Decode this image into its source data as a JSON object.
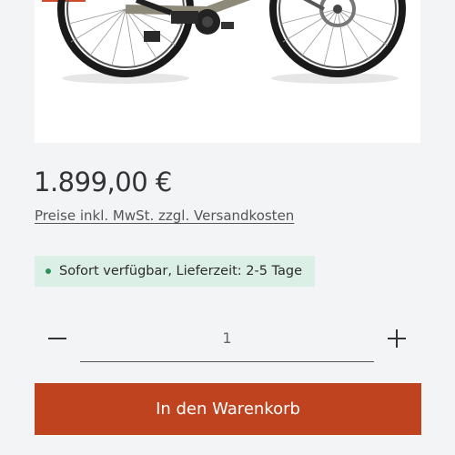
{
  "product": {
    "image_alt": "e-bike-image",
    "price": "1.899,00 €",
    "price_note": "Preise inkl. MwSt. zzgl. Versandkosten",
    "availability": "Sofort verfügbar, Lieferzeit: 2-5 Tage",
    "availability_color": "#2f8f5b",
    "availability_bg": "#dcefe6"
  },
  "quantity": {
    "value": "1",
    "minus_icon": "minus-icon",
    "plus_icon": "plus-icon"
  },
  "cart": {
    "button_label": "In den Warenkorb",
    "button_color": "#c0431f"
  }
}
